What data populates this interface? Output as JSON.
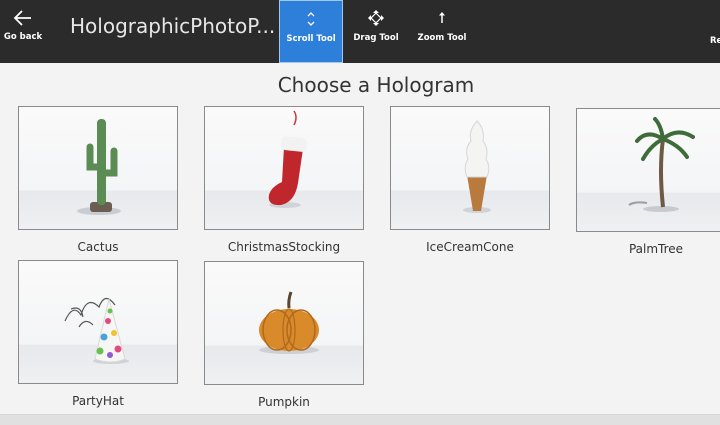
{
  "toolbar": {
    "back_label": "Go back",
    "app_title": "HolographicPhotoP...",
    "tools": [
      {
        "label": "Scroll Tool",
        "active": true
      },
      {
        "label": "Drag Tool",
        "active": false
      },
      {
        "label": "Zoom Tool",
        "active": false
      }
    ],
    "edge_label": "Re",
    "accent_color": "#2d7fd9"
  },
  "panel": {
    "title": "Choose a Hologram",
    "holograms": [
      {
        "label": "Cactus",
        "icon": "cactus-icon"
      },
      {
        "label": "ChristmasStocking",
        "icon": "christmas-stocking-icon"
      },
      {
        "label": "IceCreamCone",
        "icon": "ice-cream-cone-icon"
      },
      {
        "label": "PalmTree",
        "icon": "palm-tree-icon"
      },
      {
        "label": "PartyHat",
        "icon": "party-hat-icon"
      },
      {
        "label": "Pumpkin",
        "icon": "pumpkin-icon"
      }
    ]
  }
}
